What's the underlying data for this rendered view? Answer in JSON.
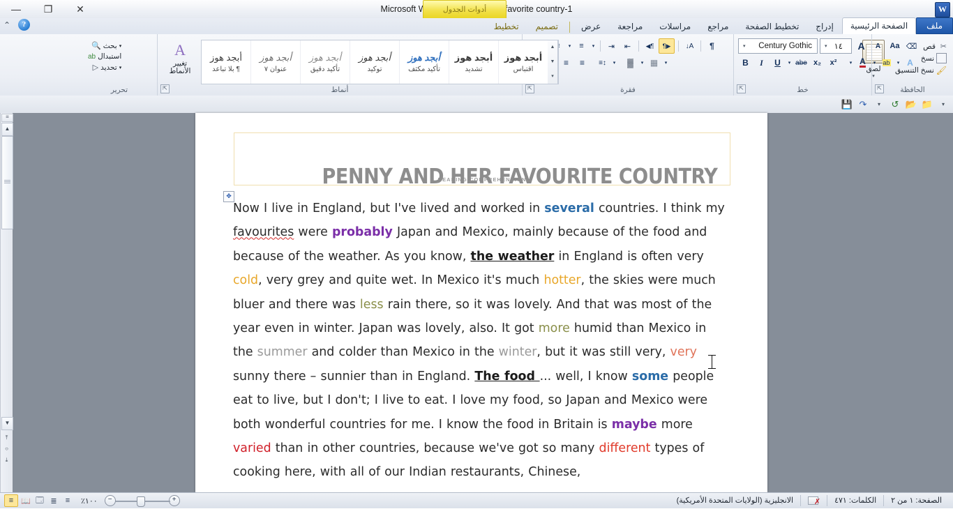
{
  "window": {
    "title": "Microsoft Word  -  penny and her favorite country-1",
    "app_logo": "W",
    "close": "✕",
    "restore": "❐",
    "minimize": "—",
    "contextual_tab_label": "أدوات الجدول",
    "help_icon": "?",
    "collapse_icon": "⌃"
  },
  "tabs": [
    {
      "label": "ملف",
      "kind": "file"
    },
    {
      "label": "الصفحة الرئيسية",
      "kind": "active"
    },
    {
      "label": "إدراج",
      "kind": "normal"
    },
    {
      "label": "تخطيط الصفحة",
      "kind": "normal"
    },
    {
      "label": "مراجع",
      "kind": "normal"
    },
    {
      "label": "مراسلات",
      "kind": "normal"
    },
    {
      "label": "مراجعة",
      "kind": "normal"
    },
    {
      "label": "عرض",
      "kind": "normal"
    },
    {
      "label": "تصميم",
      "kind": "ctx"
    },
    {
      "label": "تخطيط",
      "kind": "ctx"
    }
  ],
  "ribbon": {
    "clipboard": {
      "group_label": "الحافظة",
      "paste": "لصق",
      "cut": "قص",
      "copy": "نسخ",
      "format_painter": "نسخ التنسيق"
    },
    "font": {
      "group_label": "خط",
      "font_name": "Century Gothic",
      "font_size": "١٤",
      "grow_font": "A",
      "shrink_font": "A",
      "change_case": "Aa",
      "clear_formatting": "Aa",
      "bold": "B",
      "italic": "I",
      "underline": "U",
      "strikethrough": "abe",
      "subscript": "x₂",
      "superscript": "x²",
      "text_effects": "A",
      "highlight": "ab",
      "font_color": "A"
    },
    "paragraph": {
      "group_label": "فقرة",
      "bullets": "≡",
      "numbering": "≡",
      "multilevel": "≡",
      "decrease_indent": "⇤",
      "increase_indent": "⇥",
      "ltr_direction": "¶◀",
      "rtl_direction": "▶¶",
      "sort": "A↓",
      "show_marks": "¶",
      "align_right": "≡",
      "align_center": "≡",
      "align_left": "≡",
      "justify": "≡",
      "line_spacing": "↕≡",
      "shading": "▓",
      "borders": "▦"
    },
    "styles": {
      "group_label": "أنماط",
      "items": [
        {
          "sample": "أبجد هوز",
          "name": "اقتباس"
        },
        {
          "sample": "أبجد هوز",
          "name": "تشديد"
        },
        {
          "sample": "أبجد هوز",
          "name": "تأكيد مكثف"
        },
        {
          "sample": "أبجد هوز",
          "name": "توكيد"
        },
        {
          "sample": "أبجد هوز",
          "name": "تأكيد دقيق"
        },
        {
          "sample": "أبجد هوز",
          "name": "عنوان ٧"
        },
        {
          "sample": "أبجد هوز",
          "name": "¶ بلا تباعد"
        }
      ],
      "change_styles": "تغيير الأنماط"
    },
    "editing": {
      "group_label": "تحرير",
      "find": "بحث",
      "replace": "استبدال",
      "select": "تحديد"
    }
  },
  "qat": {
    "save": "💾",
    "undo": "↷",
    "redo": "↺",
    "open": "📂",
    "new": "📁",
    "customize": "▾"
  },
  "document": {
    "title_box": {
      "subtitle": "READING COMPREHENSION",
      "title": "PENNY AND HER FAVOURITE COUNTRY"
    },
    "move_handle_icon": "✥",
    "paragraph_runs": [
      {
        "t": "Now I live in England, but I've lived and worked in ",
        "s": "plain"
      },
      {
        "t": "several",
        "s": "b-blue"
      },
      {
        "t": " countries. I think my ",
        "s": "plain"
      },
      {
        "t": "favourites",
        "s": "spell"
      },
      {
        "t": " were ",
        "s": "plain"
      },
      {
        "t": "probably",
        "s": "b-purple"
      },
      {
        "t": " Japan and Mexico, mainly because of the food and because of the weather. As you know, ",
        "s": "plain"
      },
      {
        "t": "the weather",
        "s": "b-under"
      },
      {
        "t": " in England is often very ",
        "s": "plain"
      },
      {
        "t": "cold",
        "s": "c-gold"
      },
      {
        "t": ", very grey and quite wet. In Mexico it's much ",
        "s": "plain"
      },
      {
        "t": "hotter",
        "s": "c-gold"
      },
      {
        "t": ", the skies were much bluer and there was ",
        "s": "plain"
      },
      {
        "t": "less",
        "s": "c-olive"
      },
      {
        "t": " rain there, so it was lovely. And that was most of the year even in winter. Japan was lovely, also. It got ",
        "s": "plain"
      },
      {
        "t": "more",
        "s": "c-olive"
      },
      {
        "t": " humid than Mexico in the ",
        "s": "plain"
      },
      {
        "t": "summer",
        "s": "c-grey"
      },
      {
        "t": " and colder than Mexico in the ",
        "s": "plain"
      },
      {
        "t": "winter",
        "s": "c-grey"
      },
      {
        "t": ", but it was still very, ",
        "s": "plain"
      },
      {
        "t": "very",
        "s": "c-salmon"
      },
      {
        "t": " sunny there – sunnier than in England. ",
        "s": "plain"
      },
      {
        "t": "The food ",
        "s": "b-under"
      },
      {
        "t": "... well, I know ",
        "s": "plain"
      },
      {
        "t": "some",
        "s": "b-blue"
      },
      {
        "t": " people eat to live, but I don't; I live to eat. I love my food, so Japan and Mexico were both wonderful countries for me. I know the food in Britain is ",
        "s": "plain"
      },
      {
        "t": "maybe",
        "s": "b-purple"
      },
      {
        "t": " more ",
        "s": "plain"
      },
      {
        "t": "varied",
        "s": "c-red"
      },
      {
        "t": " than in other countries, because we've got so many ",
        "s": "plain"
      },
      {
        "t": "different",
        "s": "c-redorange"
      },
      {
        "t": " types of cooking here, with all of our Indian restaurants, Chinese,",
        "s": "plain"
      }
    ]
  },
  "status_bar": {
    "page": "الصفحة: ١ من ٢",
    "words": "الكلمات: ٤٧١",
    "proofing_icon": "proof-error-icon",
    "language": "الانجليزية (الولايات المتحدة الأمريكية)",
    "zoom_level": "١٠٠٪",
    "zoom_out": "−",
    "zoom_in": "+",
    "views": [
      {
        "name": "print-layout",
        "glyph": "≡",
        "active": true
      },
      {
        "name": "full-screen-reading",
        "glyph": "📖",
        "active": false
      },
      {
        "name": "web-layout",
        "glyph": "🗔",
        "active": false
      },
      {
        "name": "outline",
        "glyph": "≣",
        "active": false
      },
      {
        "name": "draft",
        "glyph": "≡",
        "active": false
      }
    ]
  },
  "scrollbar": {
    "up_arrow": "▲",
    "down_arrow": "▼",
    "browse_prev": "⤒",
    "browse_object": "○",
    "browse_next": "⤓",
    "split_handle": "≡"
  },
  "colors": {
    "accent_blue": "#2b6ca8",
    "accent_purple": "#7b2fa8",
    "gold": "#e8a72a",
    "olive": "#8a8f4a",
    "grey": "#9a9a9a",
    "salmon": "#e0745a",
    "red": "#d0202a",
    "title_grey": "#8d8d8d",
    "table_border": "#f0dfae",
    "ribbon_bg": "#eceff5",
    "workspace_bg": "#868e99"
  }
}
